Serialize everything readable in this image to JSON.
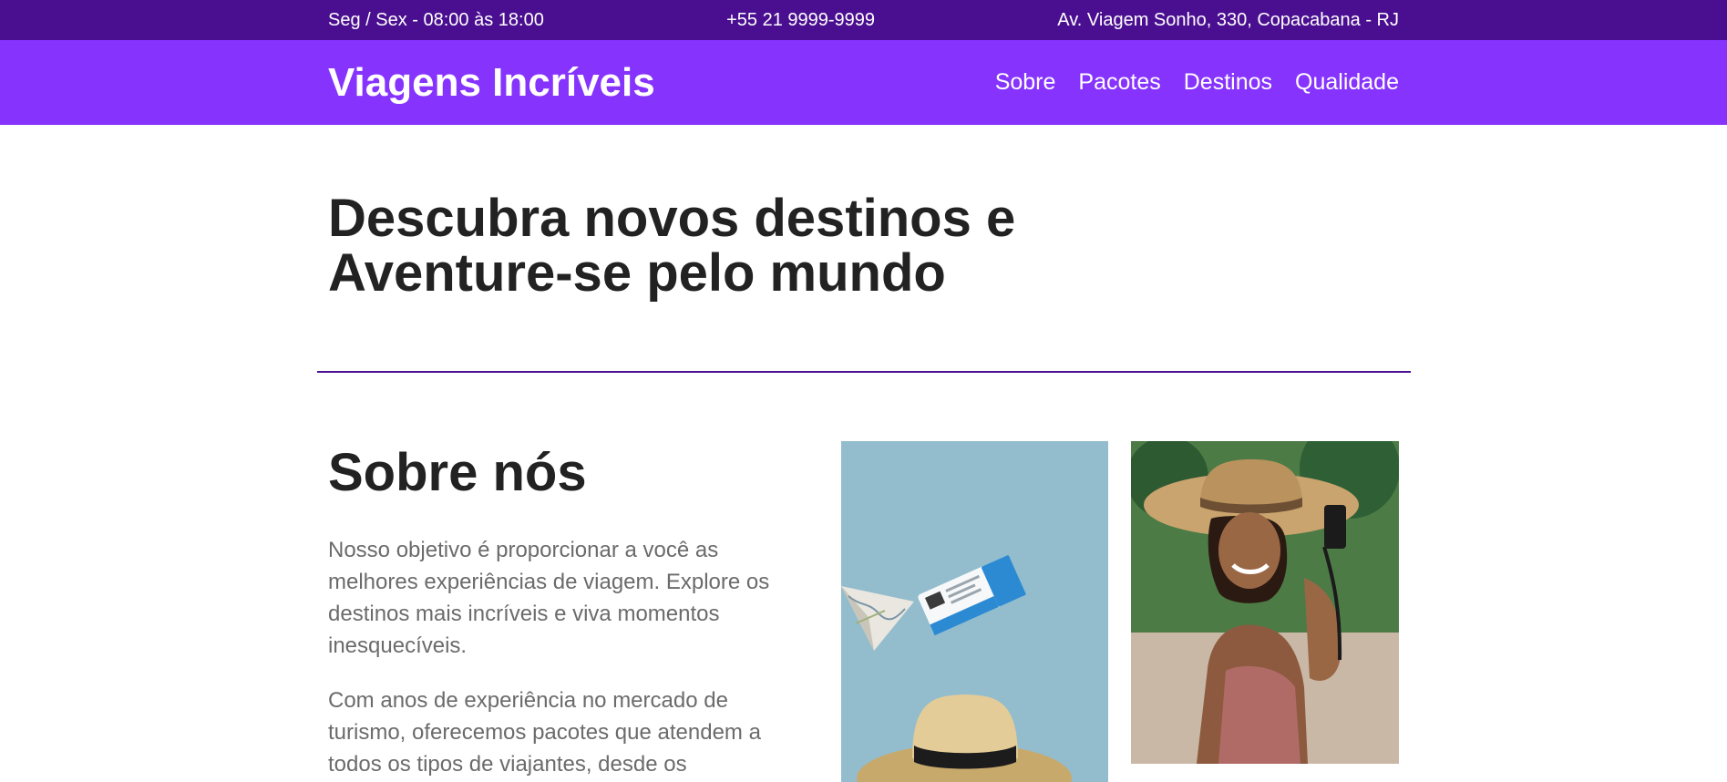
{
  "topbar": {
    "hours": "Seg / Sex - 08:00 às 18:00",
    "phone": "+55 21 9999-9999",
    "address": "Av. Viagem Sonho, 330, Copacabana - RJ"
  },
  "navbar": {
    "brand": "Viagens Incríveis",
    "links": [
      "Sobre",
      "Pacotes",
      "Destinos",
      "Qualidade"
    ]
  },
  "hero": {
    "line1": "Descubra novos destinos e",
    "line2": "Aventure-se pelo mundo"
  },
  "about": {
    "heading": "Sobre nós",
    "paragraph1": "Nosso objetivo é proporcionar a você as melhores experiências de viagem. Explore os destinos mais incríveis e viva momentos inesquecíveis.",
    "paragraph2": "Com anos de experiência no mercado de turismo, oferecemos pacotes que atendem a todos os tipos de viajantes, desde os"
  },
  "colors": {
    "topbar_bg": "#4a0f90",
    "navbar_bg": "#8633fe",
    "heading_text": "#222222",
    "body_text": "#6b6b6b"
  }
}
